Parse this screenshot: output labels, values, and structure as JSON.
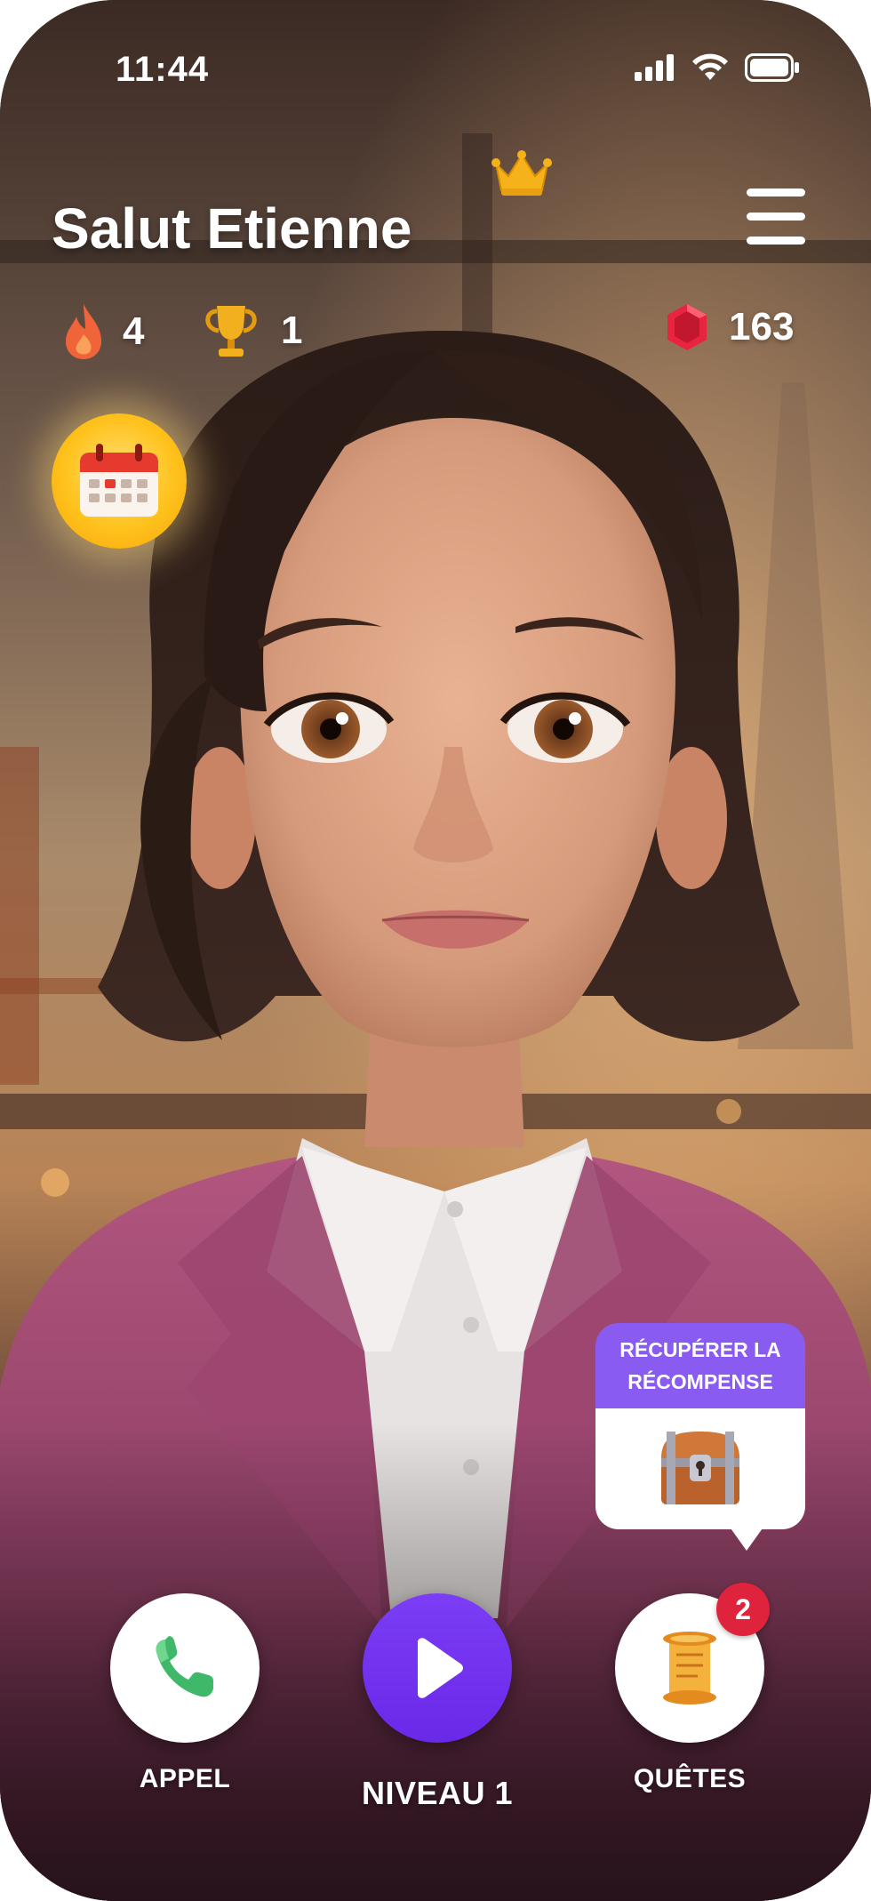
{
  "status_bar": {
    "time": "11:44"
  },
  "header": {
    "greeting": "Salut Etienne"
  },
  "stats": {
    "streak": "4",
    "trophies": "1",
    "gems": "163"
  },
  "reward": {
    "line1": "RÉCUPÉRER LA",
    "line2": "RÉCOMPENSE"
  },
  "nav": {
    "call_label": "APPEL",
    "level_label": "NIVEAU 1",
    "quests_label": "QUÊTES",
    "quests_badge": "2"
  },
  "colors": {
    "accent_purple": "#6a28e8",
    "badge_red": "#e0233c",
    "gem_red": "#e8243f",
    "bubble_purple": "#8a5bf0"
  },
  "icons": [
    "flame-icon",
    "trophy-icon",
    "gem-icon",
    "crown-icon",
    "menu-icon",
    "calendar-icon",
    "treasure-chest-icon",
    "phone-icon",
    "play-icon",
    "scroll-icon",
    "signal-icon",
    "wifi-icon",
    "battery-icon"
  ]
}
